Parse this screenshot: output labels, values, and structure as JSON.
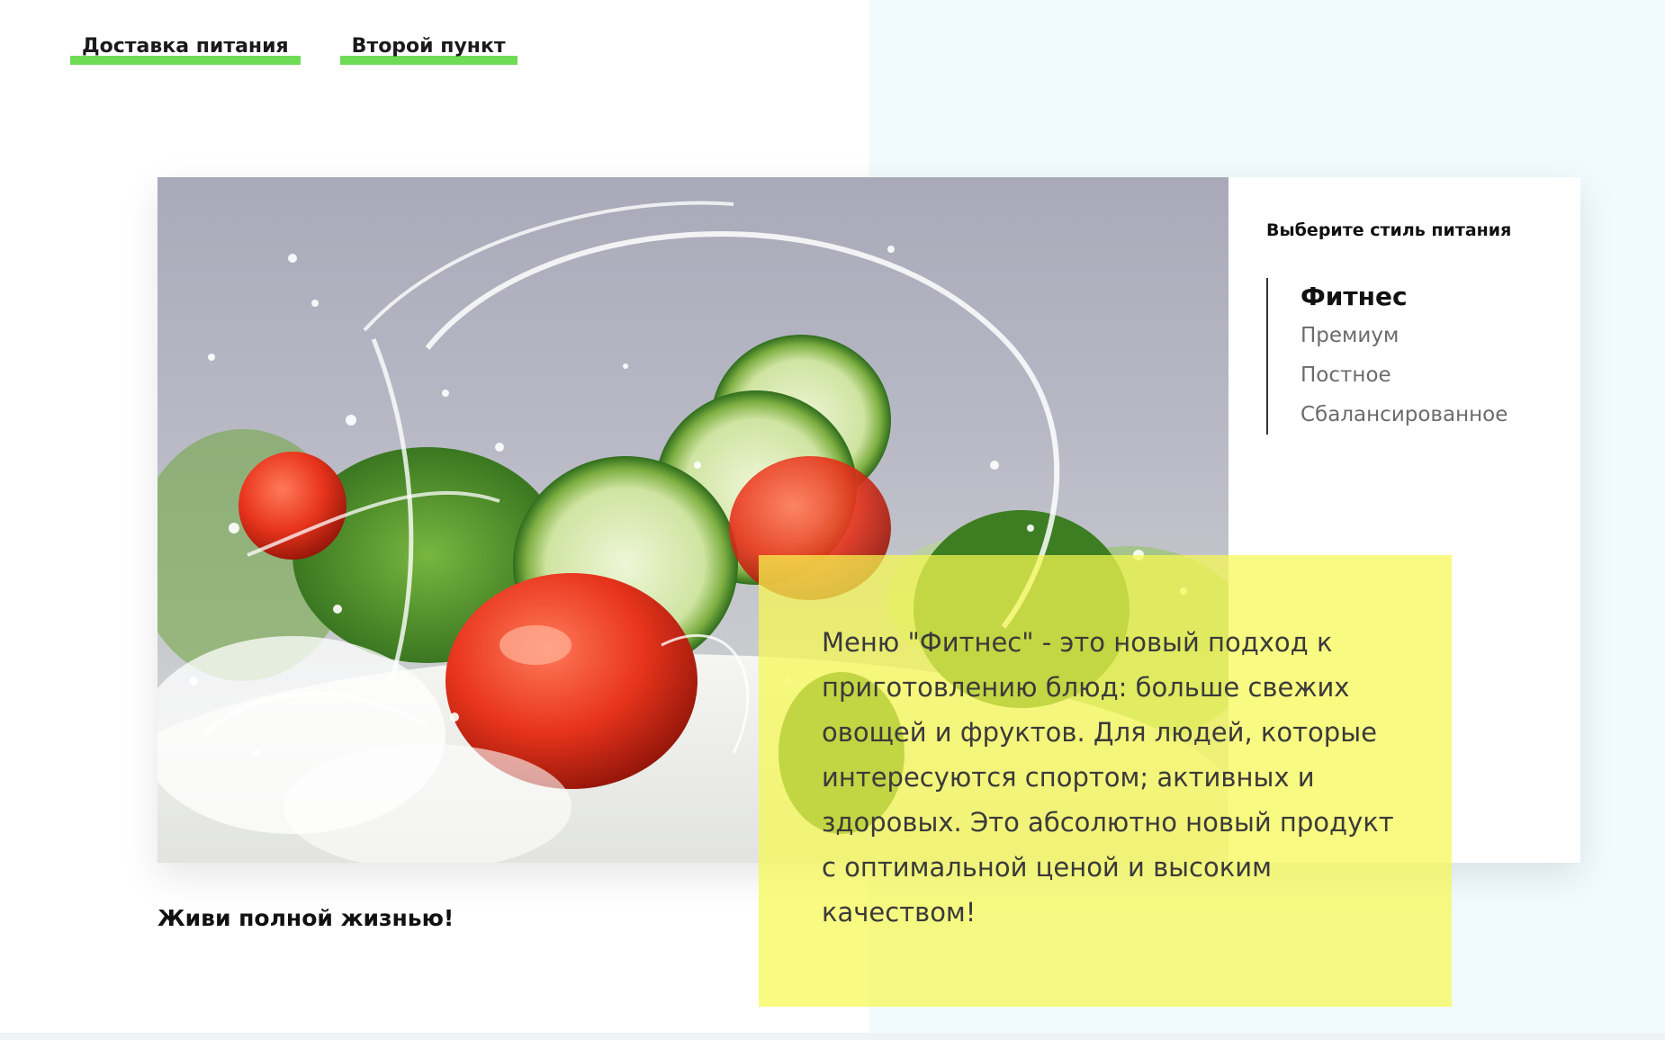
{
  "nav": {
    "items": [
      {
        "label": "Доставка питания"
      },
      {
        "label": "Второй пункт"
      }
    ],
    "underline_color": "#6fdc56"
  },
  "hero": {
    "image_alt": "salad-splash-photo",
    "panel_title": "Выберите стиль питания",
    "styles": [
      {
        "label": "Фитнес",
        "active": true
      },
      {
        "label": "Премиум",
        "active": false
      },
      {
        "label": "Постное",
        "active": false
      },
      {
        "label": "Сбалансированное",
        "active": false
      }
    ]
  },
  "description": {
    "text": "Меню \"Фитнес\" - это новый подход к приготовлению блюд: больше свежих овощей и фруктов. Для людей, которые интересуются спортом; активных и здоровых. Это абсолютно новый продукт с оптимальной ценой и высоким качеством!",
    "background": "#f6f850"
  },
  "tagline": "Живи полной жизнью!",
  "colors": {
    "right_background": "#f1fbfd",
    "accent_green": "#6fdc56",
    "accent_yellow": "#f6f850"
  }
}
